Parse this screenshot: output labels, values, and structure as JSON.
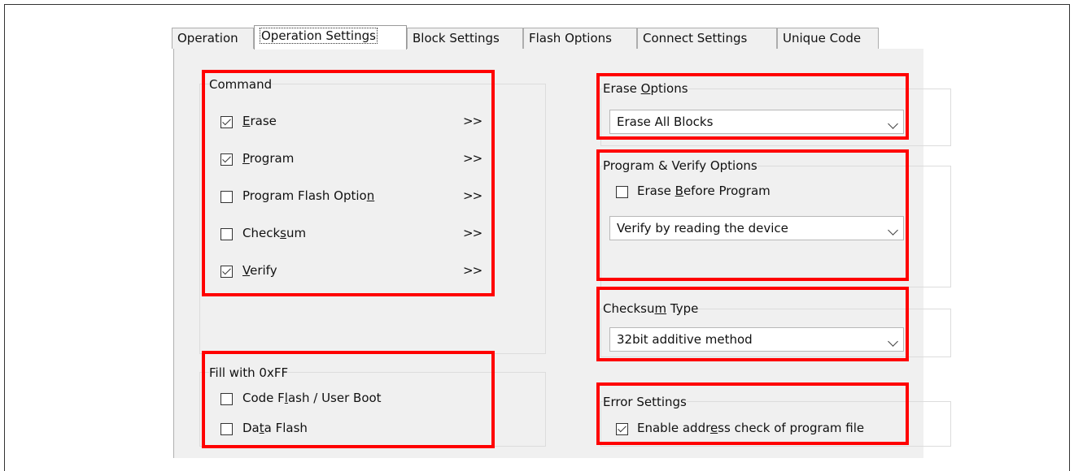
{
  "tabs": [
    "Operation",
    "Operation Settings",
    "Block Settings",
    "Flash Options",
    "Connect Settings",
    "Unique Code"
  ],
  "command": {
    "title": "Command",
    "items": [
      {
        "pre": "",
        "u": "E",
        "post": "rase",
        "checked": true,
        "arrow": ">>"
      },
      {
        "pre": "",
        "u": "P",
        "post": "rogram",
        "checked": true,
        "arrow": ">>"
      },
      {
        "pre": "Program Flash Optio",
        "u": "n",
        "post": "",
        "checked": false,
        "arrow": ">>"
      },
      {
        "pre": "Check",
        "u": "s",
        "post": "um",
        "checked": false,
        "arrow": ">>"
      },
      {
        "pre": "",
        "u": "V",
        "post": "erify",
        "checked": true,
        "arrow": ">>"
      }
    ]
  },
  "fill": {
    "title": "Fill with 0xFF",
    "items": [
      {
        "pre": "Code F",
        "u": "l",
        "post": "ash / User Boot",
        "checked": false
      },
      {
        "pre": "Da",
        "u": "t",
        "post": "a Flash",
        "checked": false
      }
    ]
  },
  "erase_options": {
    "pre": "Erase ",
    "u": "O",
    "post": "ptions",
    "value": "Erase All Blocks"
  },
  "program_verify": {
    "title": "Program & Verify Options",
    "checkbox": {
      "pre": "Erase ",
      "u": "B",
      "post": "efore Program",
      "checked": false
    },
    "value": "Verify by reading the device"
  },
  "checksum_type": {
    "pre": "Checksu",
    "u": "m",
    "post": " Type",
    "value": "32bit additive method"
  },
  "error_settings": {
    "title": "Error Settings",
    "checkbox": {
      "pre": "Enable addr",
      "u": "e",
      "post": "ss check of program file",
      "checked": true
    }
  },
  "colors": {
    "highlight": "#ff0000",
    "panel": "#f0f0f0"
  }
}
